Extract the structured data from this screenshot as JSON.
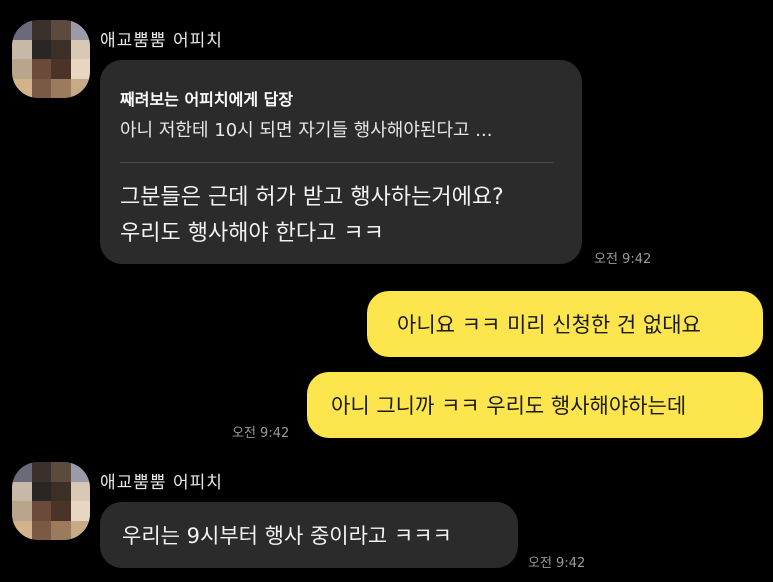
{
  "messages": [
    {
      "sender": "애교뿜뿜 어피치",
      "reply_to": "째려보는 어피치에게 답장",
      "quoted": "아니 저한테 10시 되면 자기들 행사해야된다고 ...",
      "lines": [
        "그분들은 근데 허가 받고 행사하는거에요?",
        "우리도 행사해야 한다고 ㅋㅋ"
      ],
      "time": "오전 9:42"
    },
    {
      "mine": true,
      "bubbles": [
        "아니요 ㅋㅋ 미리 신청한 건 없대요",
        "아니 그니까 ㅋㅋ 우리도 행사해야하는데"
      ],
      "time": "오전 9:42"
    },
    {
      "sender": "애교뿜뿜 어피치",
      "text": "우리는 9시부터 행사 중이라고 ㅋㅋㅋ",
      "time": "오전 9:42"
    }
  ],
  "colors": {
    "background": "#000000",
    "incoming_bubble": "#2b2b2b",
    "outgoing_bubble": "#fde54d",
    "time_text": "#9a9a9a"
  }
}
